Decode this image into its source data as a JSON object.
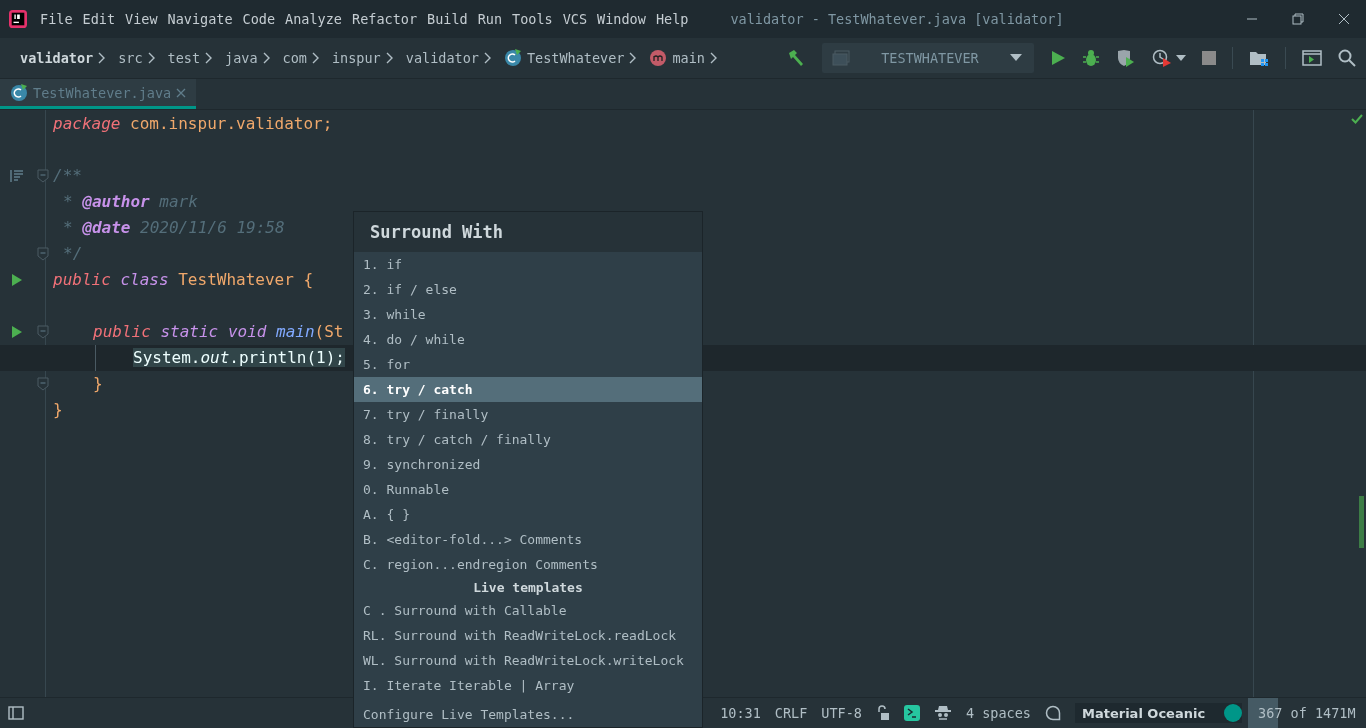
{
  "menu": [
    "File",
    "Edit",
    "View",
    "Navigate",
    "Code",
    "Analyze",
    "Refactor",
    "Build",
    "Run",
    "Tools",
    "VCS",
    "Window",
    "Help"
  ],
  "window": {
    "title": "validator - TestWhatever.java [validator]"
  },
  "breadcrumbs": [
    {
      "label": "validator",
      "kind": "root"
    },
    {
      "label": "src",
      "kind": "folder"
    },
    {
      "label": "test",
      "kind": "folder"
    },
    {
      "label": "java",
      "kind": "folder"
    },
    {
      "label": "com",
      "kind": "folder"
    },
    {
      "label": "inspur",
      "kind": "folder"
    },
    {
      "label": "validator",
      "kind": "folder"
    },
    {
      "label": "TestWhatever",
      "kind": "class"
    },
    {
      "label": "main",
      "kind": "method"
    }
  ],
  "run_config": {
    "label": "TESTWHATEVER"
  },
  "tabs": [
    {
      "label": "TestWhatever.java",
      "selected": true
    }
  ],
  "code_lines": [
    {
      "kind": "top",
      "run_marker": false,
      "doc_marker": false,
      "fold": false,
      "current": false,
      "tokens": [
        {
          "kind": "kw",
          "text": "package "
        },
        {
          "kind": "plain",
          "text": "com.inspur.validator;"
        }
      ]
    },
    {
      "kind": "blank"
    },
    {
      "kind": "top",
      "run_marker": false,
      "doc_marker": true,
      "fold": true,
      "current": false,
      "tokens": [
        {
          "kind": "comment",
          "text": "/**"
        }
      ]
    },
    {
      "kind": "doc",
      "run_marker": false,
      "doc_marker": false,
      "fold": false,
      "current": false,
      "tokens": [
        {
          "kind": "comment",
          "text": "* "
        },
        {
          "kind": "tag",
          "text": "@author"
        },
        {
          "kind": "comment",
          "text": " mark"
        }
      ]
    },
    {
      "kind": "doc",
      "run_marker": false,
      "doc_marker": false,
      "fold": false,
      "current": false,
      "tokens": [
        {
          "kind": "comment",
          "text": "* "
        },
        {
          "kind": "tag",
          "text": "@date"
        },
        {
          "kind": "comment",
          "text": " 2020/11/6 19:58"
        }
      ]
    },
    {
      "kind": "doc",
      "run_marker": false,
      "doc_marker": false,
      "fold": true,
      "current": false,
      "tokens": [
        {
          "kind": "comment",
          "text": "*/"
        }
      ]
    },
    {
      "kind": "top",
      "run_marker": true,
      "doc_marker": false,
      "fold": false,
      "current": false,
      "tokens": [
        {
          "kind": "kw",
          "text": "public "
        },
        {
          "kind": "kw2",
          "text": "class "
        },
        {
          "kind": "plain",
          "text": "TestWhatever {"
        }
      ]
    },
    {
      "kind": "blank"
    },
    {
      "kind": "member",
      "run_marker": true,
      "doc_marker": false,
      "fold": true,
      "current": false,
      "tokens": [
        {
          "kind": "kw",
          "text": "public "
        },
        {
          "kind": "kw2",
          "text": "static "
        },
        {
          "kind": "kw2",
          "text": "void "
        },
        {
          "kind": "fn",
          "text": "main"
        },
        {
          "kind": "plain",
          "text": "(St"
        }
      ]
    },
    {
      "kind": "statement",
      "run_marker": false,
      "doc_marker": false,
      "fold": false,
      "current": true,
      "tokens": [
        {
          "kind": "sel",
          "text": "System."
        },
        {
          "kind": "selit",
          "text": "out"
        },
        {
          "kind": "sel",
          "text": ".println(1);"
        }
      ]
    },
    {
      "kind": "member",
      "run_marker": false,
      "doc_marker": false,
      "fold": true,
      "current": false,
      "tokens": [
        {
          "kind": "plain",
          "text": "}"
        }
      ]
    },
    {
      "kind": "top",
      "run_marker": false,
      "doc_marker": false,
      "fold": false,
      "current": false,
      "tokens": [
        {
          "kind": "plain",
          "text": "}"
        }
      ]
    }
  ],
  "popup": {
    "title": "Surround With",
    "items": [
      {
        "kind": "item",
        "label": "1. if",
        "selected": false
      },
      {
        "kind": "item",
        "label": "2. if / else",
        "selected": false
      },
      {
        "kind": "item",
        "label": "3. while",
        "selected": false
      },
      {
        "kind": "item",
        "label": "4. do / while",
        "selected": false
      },
      {
        "kind": "item",
        "label": "5. for",
        "selected": false
      },
      {
        "kind": "item",
        "label": "6. try / catch",
        "selected": true
      },
      {
        "kind": "item",
        "label": "7. try / finally",
        "selected": false
      },
      {
        "kind": "item",
        "label": "8. try / catch / finally",
        "selected": false
      },
      {
        "kind": "item",
        "label": "9. synchronized",
        "selected": false
      },
      {
        "kind": "item",
        "label": "0. Runnable",
        "selected": false
      },
      {
        "kind": "item",
        "label": "A. { }",
        "selected": false
      },
      {
        "kind": "item",
        "label": "B. <editor-fold...> Comments",
        "selected": false
      },
      {
        "kind": "item",
        "label": "C. region...endregion Comments",
        "selected": false
      },
      {
        "kind": "header",
        "label": "Live templates"
      },
      {
        "kind": "item",
        "label": "C . Surround with Callable",
        "selected": false
      },
      {
        "kind": "item",
        "label": "RL. Surround with ReadWriteLock.readLock",
        "selected": false
      },
      {
        "kind": "item",
        "label": "WL. Surround with ReadWriteLock.writeLock",
        "selected": false
      },
      {
        "kind": "item",
        "label": "I. Iterate Iterable | Array",
        "selected": false
      }
    ],
    "footer": "Configure Live Templates..."
  },
  "status_bar": {
    "position": "10:31",
    "line_separator": "CRLF",
    "encoding": "UTF-8",
    "indent": "4 spaces",
    "theme": "Material Oceanic",
    "memory": {
      "label": "367 of 1471M",
      "level": 0.25
    }
  }
}
